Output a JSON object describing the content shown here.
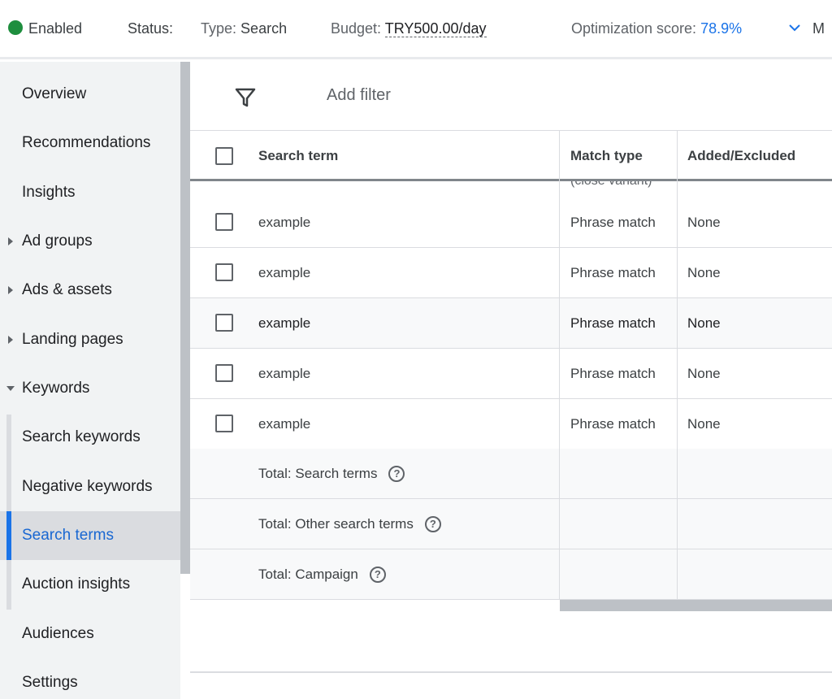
{
  "topbar": {
    "status_value": "Enabled",
    "status_label": "Status:",
    "type_label": "Type:",
    "type_value": "Search",
    "budget_label": "Budget:",
    "budget_value": "TRY500.00/day",
    "optimization_label": "Optimization score:",
    "optimization_value": "78.9%",
    "more_icon": "chevron-down-icon",
    "more_label": "M"
  },
  "sidebar": {
    "items": [
      {
        "label": "Overview"
      },
      {
        "label": "Recommendations"
      },
      {
        "label": "Insights"
      },
      {
        "label": "Ad groups"
      },
      {
        "label": "Ads & assets"
      },
      {
        "label": "Landing pages"
      },
      {
        "label": "Keywords"
      },
      {
        "label": "Search keywords"
      },
      {
        "label": "Negative keywords"
      },
      {
        "label": "Search terms"
      },
      {
        "label": "Auction insights"
      },
      {
        "label": "Audiences"
      },
      {
        "label": "Settings"
      }
    ],
    "selected": "Search terms"
  },
  "toolbar": {
    "filter_icon": "filter-icon",
    "add_filter_label": "Add filter"
  },
  "table": {
    "columns": [
      "Search term",
      "Match type",
      "Added/Excluded"
    ],
    "partial_text": "(close variant)",
    "rows": [
      {
        "term": "example",
        "match": "Phrase match",
        "added": "None"
      },
      {
        "term": "example",
        "match": "Phrase match",
        "added": "None"
      },
      {
        "term": "example",
        "match": "Phrase match",
        "added": "None"
      },
      {
        "term": "example",
        "match": "Phrase match",
        "added": "None"
      },
      {
        "term": "example",
        "match": "Phrase match",
        "added": "None"
      }
    ],
    "totals": [
      {
        "label": "Total: Search terms"
      },
      {
        "label": "Total: Other search terms"
      },
      {
        "label": "Total: Campaign"
      }
    ]
  },
  "colors": {
    "accent": "#1a73e8",
    "enabled": "#1e8e3e",
    "selected_bg": "#dadce0"
  }
}
